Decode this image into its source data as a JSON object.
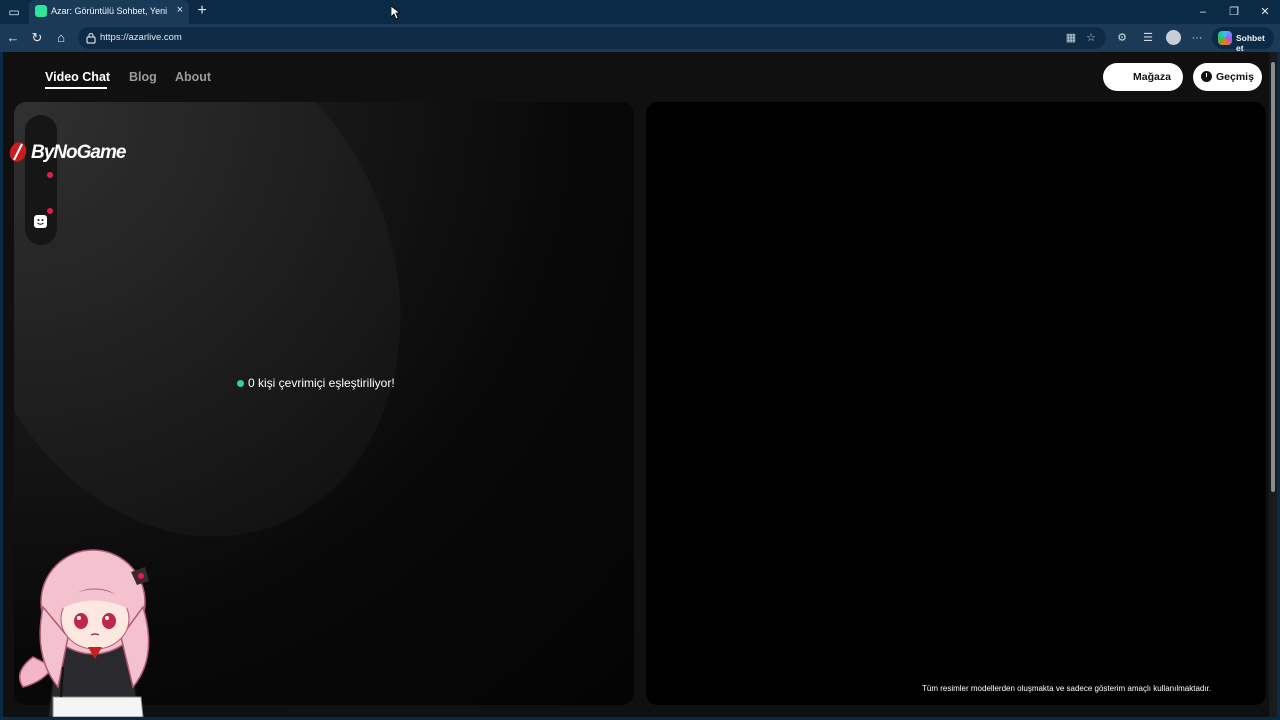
{
  "browser": {
    "tab_title": "Azar: Görüntülü Sohbet, Yeni Arkadaşlar",
    "tab_close": "×",
    "new_tab": "+",
    "window_controls": {
      "minimize": "–",
      "restore": "❐",
      "close": "✕"
    },
    "nav": {
      "back": "←",
      "reload": "↻",
      "home": "⌂"
    },
    "url": "https://azarlive.com",
    "copilot_label": "Sohbet et",
    "more_label": "···"
  },
  "site": {
    "nav": {
      "video_chat": "Video Chat",
      "blog": "Blog",
      "about": "About"
    },
    "store_button": "Mağaza",
    "history_button": "Geçmiş",
    "overlay_logo": "ByNoGame",
    "status_text": "0 kişi çevrimiçi eşleştiriliyor!",
    "disclaimer": "Tüm resimler modellerden oluşmakta ve sadece gösterim amaçlı kullanılmaktadır."
  },
  "colors": {
    "browser_frame": "#0b2a45",
    "page_bg": "#101010",
    "status_dot": "#34d399",
    "notification_dot": "#e11d48"
  }
}
